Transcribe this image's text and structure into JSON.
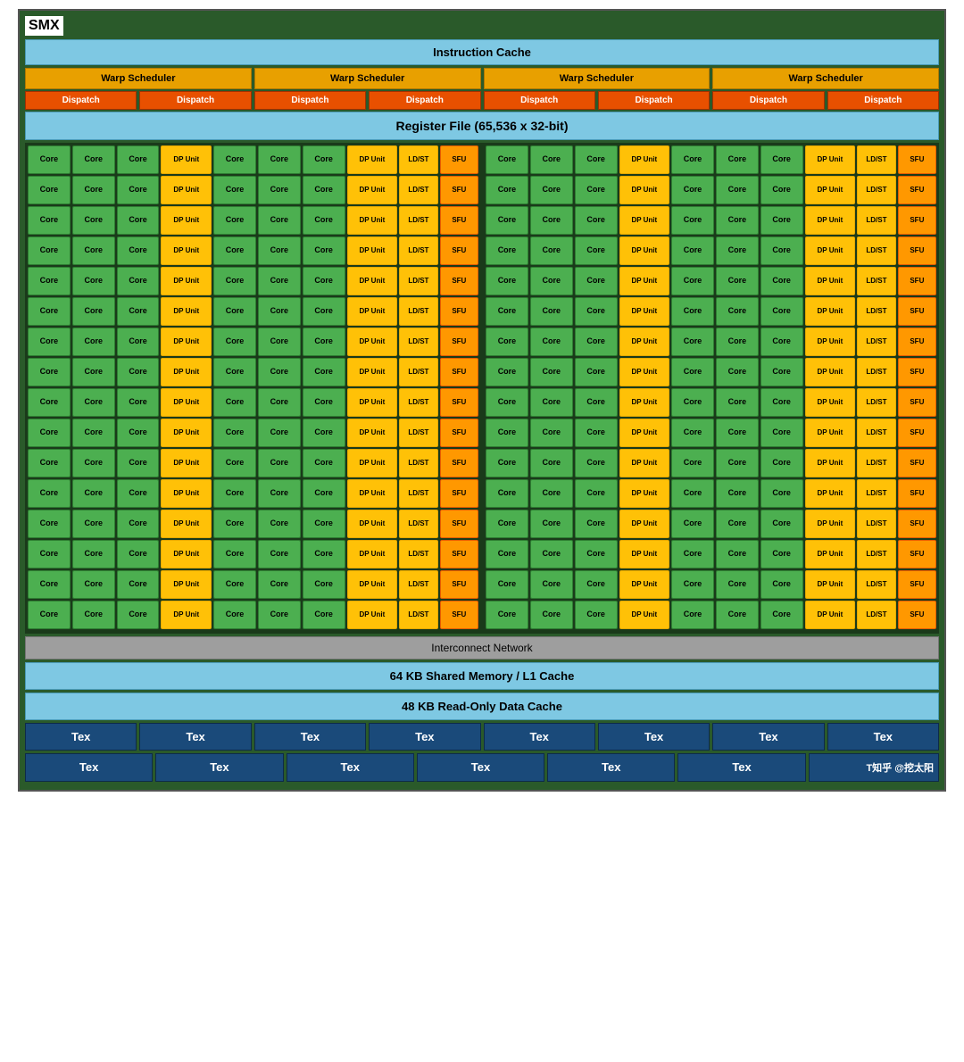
{
  "title": "SMX",
  "instruction_cache": "Instruction Cache",
  "warp_schedulers": [
    "Warp Scheduler",
    "Warp Scheduler",
    "Warp Scheduler",
    "Warp Scheduler"
  ],
  "dispatch_units": [
    "Dispatch",
    "Dispatch",
    "Dispatch",
    "Dispatch",
    "Dispatch",
    "Dispatch",
    "Dispatch",
    "Dispatch"
  ],
  "register_file": "Register File (65,536 x 32-bit)",
  "cells": {
    "core": "Core",
    "dp_unit": "DP Unit",
    "ldst": "LD/ST",
    "sfu": "SFU"
  },
  "interconnect": "Interconnect Network",
  "shared_memory": "64 KB Shared Memory / L1 Cache",
  "readonly_cache": "48 KB Read-Only Data Cache",
  "tex_units_row1": [
    "Tex",
    "Tex",
    "Tex",
    "Tex",
    "Tex",
    "Tex",
    "Tex",
    "Tex"
  ],
  "tex_units_row2_label": [
    "Tex",
    "Tex",
    "Tex",
    "Tex",
    "Tex",
    "Tex",
    "T知乎 @挖太阳"
  ],
  "num_core_rows": 16
}
